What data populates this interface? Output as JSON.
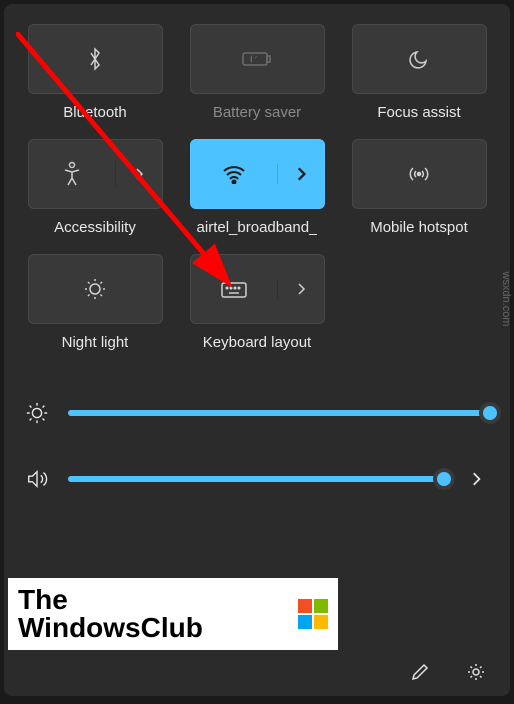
{
  "tiles": {
    "bluetooth": {
      "label": "Bluetooth"
    },
    "battery_saver": {
      "label": "Battery saver"
    },
    "focus_assist": {
      "label": "Focus assist"
    },
    "accessibility": {
      "label": "Accessibility"
    },
    "wifi": {
      "label": "airtel_broadband_"
    },
    "mobile_hotspot": {
      "label": "Mobile hotspot"
    },
    "night_light": {
      "label": "Night light"
    },
    "keyboard_layout": {
      "label": "Keyboard layout"
    }
  },
  "sliders": {
    "brightness": {
      "value": 100
    },
    "volume": {
      "value": 98
    }
  },
  "watermark": {
    "line1": "The",
    "line2": "WindowsClub"
  },
  "side_text": "wsxdn.com",
  "colors": {
    "accent": "#4cc2ff"
  }
}
